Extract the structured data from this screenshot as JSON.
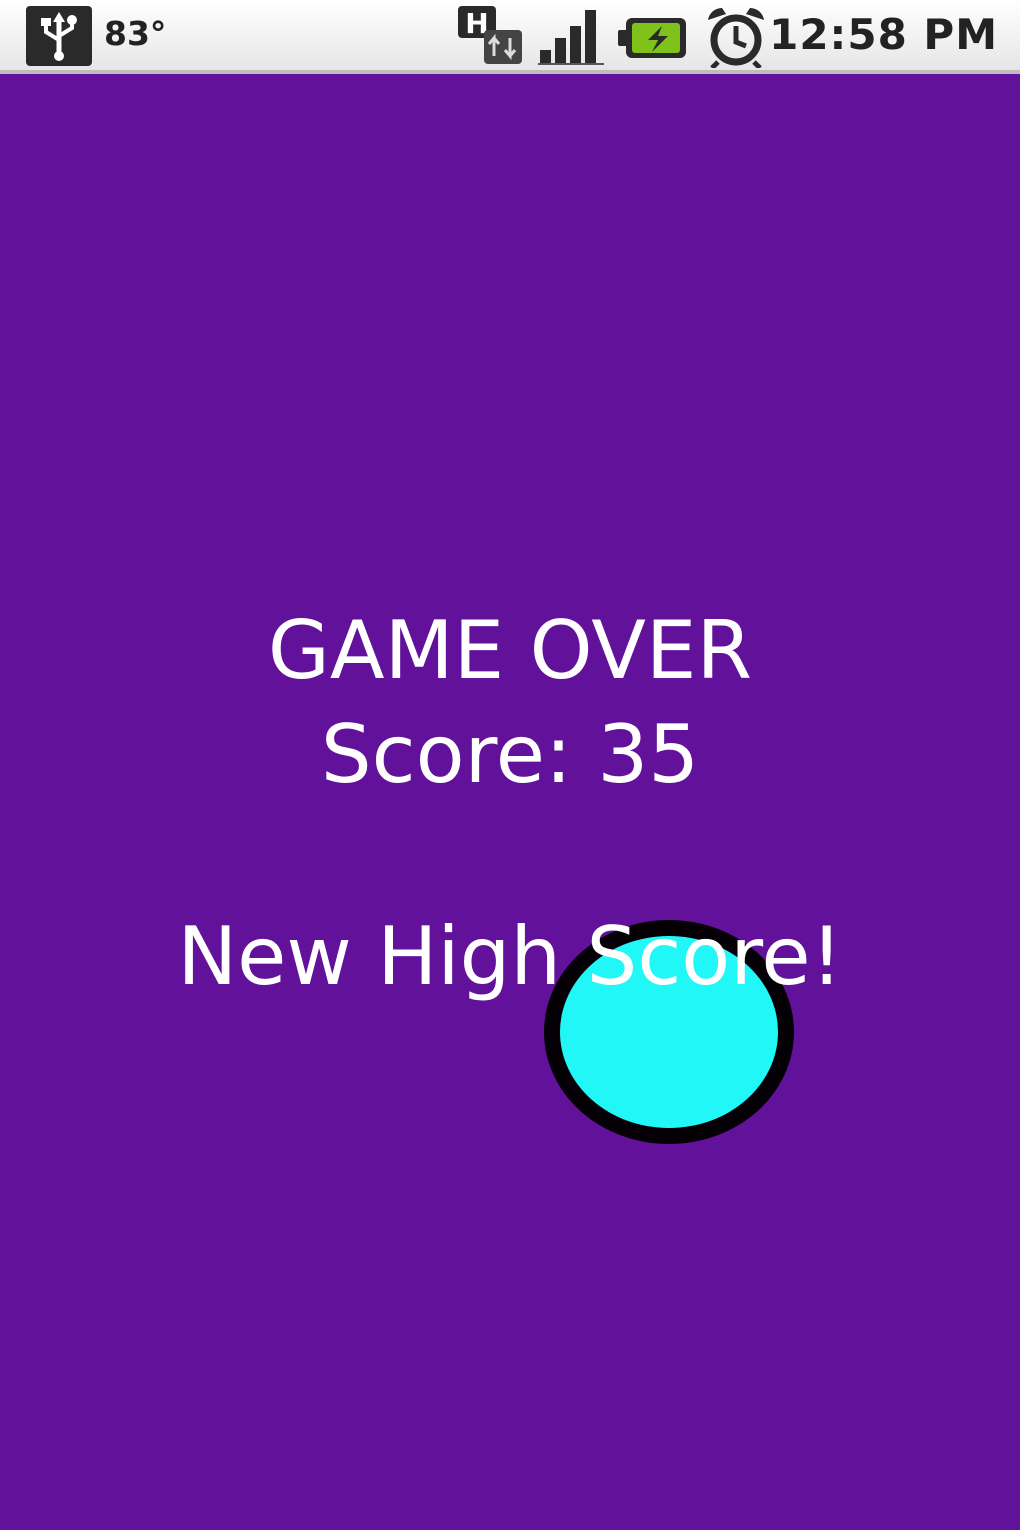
{
  "status_bar": {
    "temperature": "83°",
    "time": "12:58 PM",
    "icons": [
      "usb-icon",
      "hspa-data-icon",
      "signal-bars-icon",
      "battery-charging-icon",
      "alarm-clock-icon"
    ]
  },
  "game": {
    "title": "GAME OVER",
    "score_text": "Score: 35",
    "high_score_text": "New High Score!",
    "colors": {
      "background": "#62119a",
      "ball_fill": "#22f7f7",
      "ball_outline": "#050005",
      "text": "#ffffff"
    }
  }
}
